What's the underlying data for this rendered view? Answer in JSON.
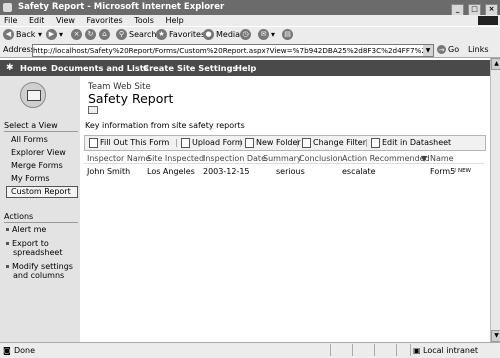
{
  "window": {
    "title": "Safety Report - Microsoft Internet Explorer",
    "buttons": [
      "_",
      "□",
      "×"
    ]
  },
  "menu": [
    "File",
    "Edit",
    "View",
    "Favorites",
    "Tools",
    "Help"
  ],
  "toolbar": {
    "back": "Back",
    "search": "Search",
    "favorites": "Favorites",
    "media": "Media"
  },
  "address": {
    "label": "Address",
    "url": "http://localhost/Safety%20Report/Forms/Custom%20Report.aspx?View=%7b942DBA25%2d8F3C%2d4FF7%2dA752%2d1",
    "go": "Go",
    "links": "Links"
  },
  "spnav": [
    "Home",
    "Documents and Lists",
    "Create",
    "Site Settings",
    "Help"
  ],
  "site": {
    "subtitle": "Team Web Site",
    "title": "Safety Report",
    "description": "Key information from site safety reports"
  },
  "leftnav": {
    "select_view": "Select a View",
    "views": [
      "All Forms",
      "Explorer View",
      "Merge Forms",
      "My Forms",
      "Custom Report"
    ],
    "selected": "Custom Report",
    "actions_title": "Actions",
    "actions": [
      "Alert me",
      "Export to",
      "spreadsheet",
      "Modify settings",
      "and columns"
    ]
  },
  "list_toolbar": [
    "Fill Out This Form",
    "Upload Form",
    "New Folder",
    "Change Filter",
    "Edit in Datasheet"
  ],
  "table": {
    "headers": [
      "Inspector Name",
      "Site Inspected",
      "Inspection Date",
      "Summary",
      "Conclusion",
      "Action Recommended",
      "Name"
    ],
    "rows": [
      {
        "inspector": "John Smith",
        "site": "Los Angeles",
        "date": "2003-12-15",
        "conclusion": "serious",
        "action": "escalate",
        "name": "Form5",
        "badge": "! NEW"
      }
    ]
  },
  "status": {
    "text": "Done",
    "zone": "Local intranet"
  }
}
